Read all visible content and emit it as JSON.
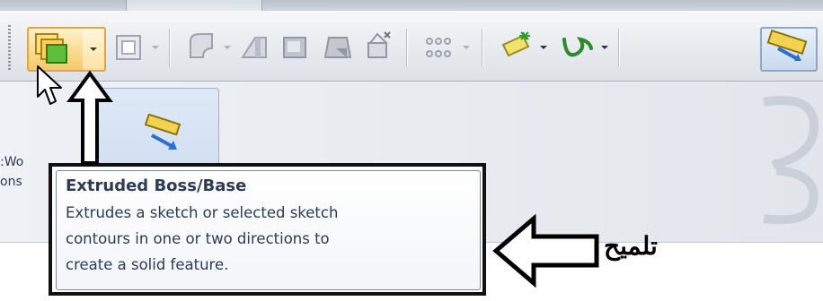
{
  "tooltip": {
    "title": "Extruded Boss/Base",
    "lines": [
      "Extrudes a sketch or selected sketch",
      "contours in one or two directions to",
      "create a solid feature."
    ]
  },
  "annotation": {
    "label": "تلميح"
  },
  "background_text": {
    "line1": ":Wo",
    "line2": "ons"
  },
  "colors": {
    "annotation_stroke": "#000000",
    "tooltip_title": "#2c3b57",
    "highlight_border": "#e3a34a"
  }
}
